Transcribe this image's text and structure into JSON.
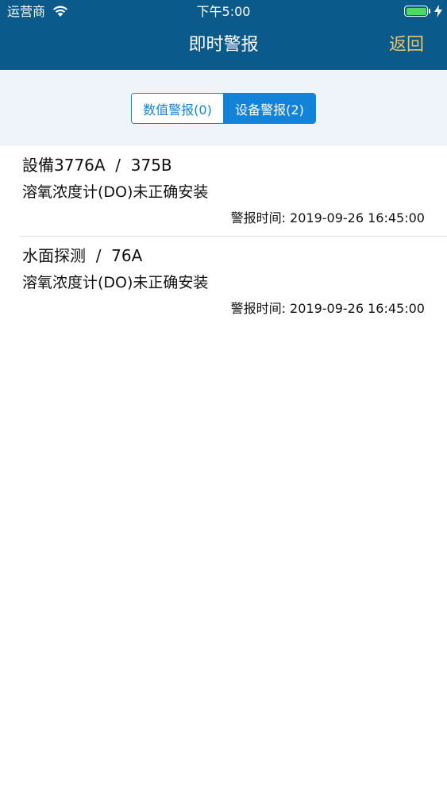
{
  "status_bar": {
    "carrier": "运营商",
    "time": "下午5:00",
    "battery_level": 1.0,
    "battery_color": "#4cd964",
    "icons": [
      "wifi-icon",
      "battery-icon",
      "charging-bolt-icon"
    ]
  },
  "nav": {
    "title": "即时警报",
    "back_label": "返回",
    "bar_color": "#0a5a8c",
    "back_color": "#e8c56a"
  },
  "filter": {
    "tabs": [
      {
        "label": "数值警报(0)",
        "selected": false
      },
      {
        "label": "设备警报(2)",
        "selected": true
      }
    ],
    "accent_color": "#1383d9"
  },
  "alerts": [
    {
      "title": "設備3776A  /  375B",
      "description": "溶氧浓度计(DO)未正确安装",
      "time": "警报时间: 2019-09-26 16:45:00"
    },
    {
      "title": "水面探测  /  76A",
      "description": "溶氧浓度计(DO)未正确安装",
      "time": "警报时间: 2019-09-26 16:45:00"
    }
  ]
}
